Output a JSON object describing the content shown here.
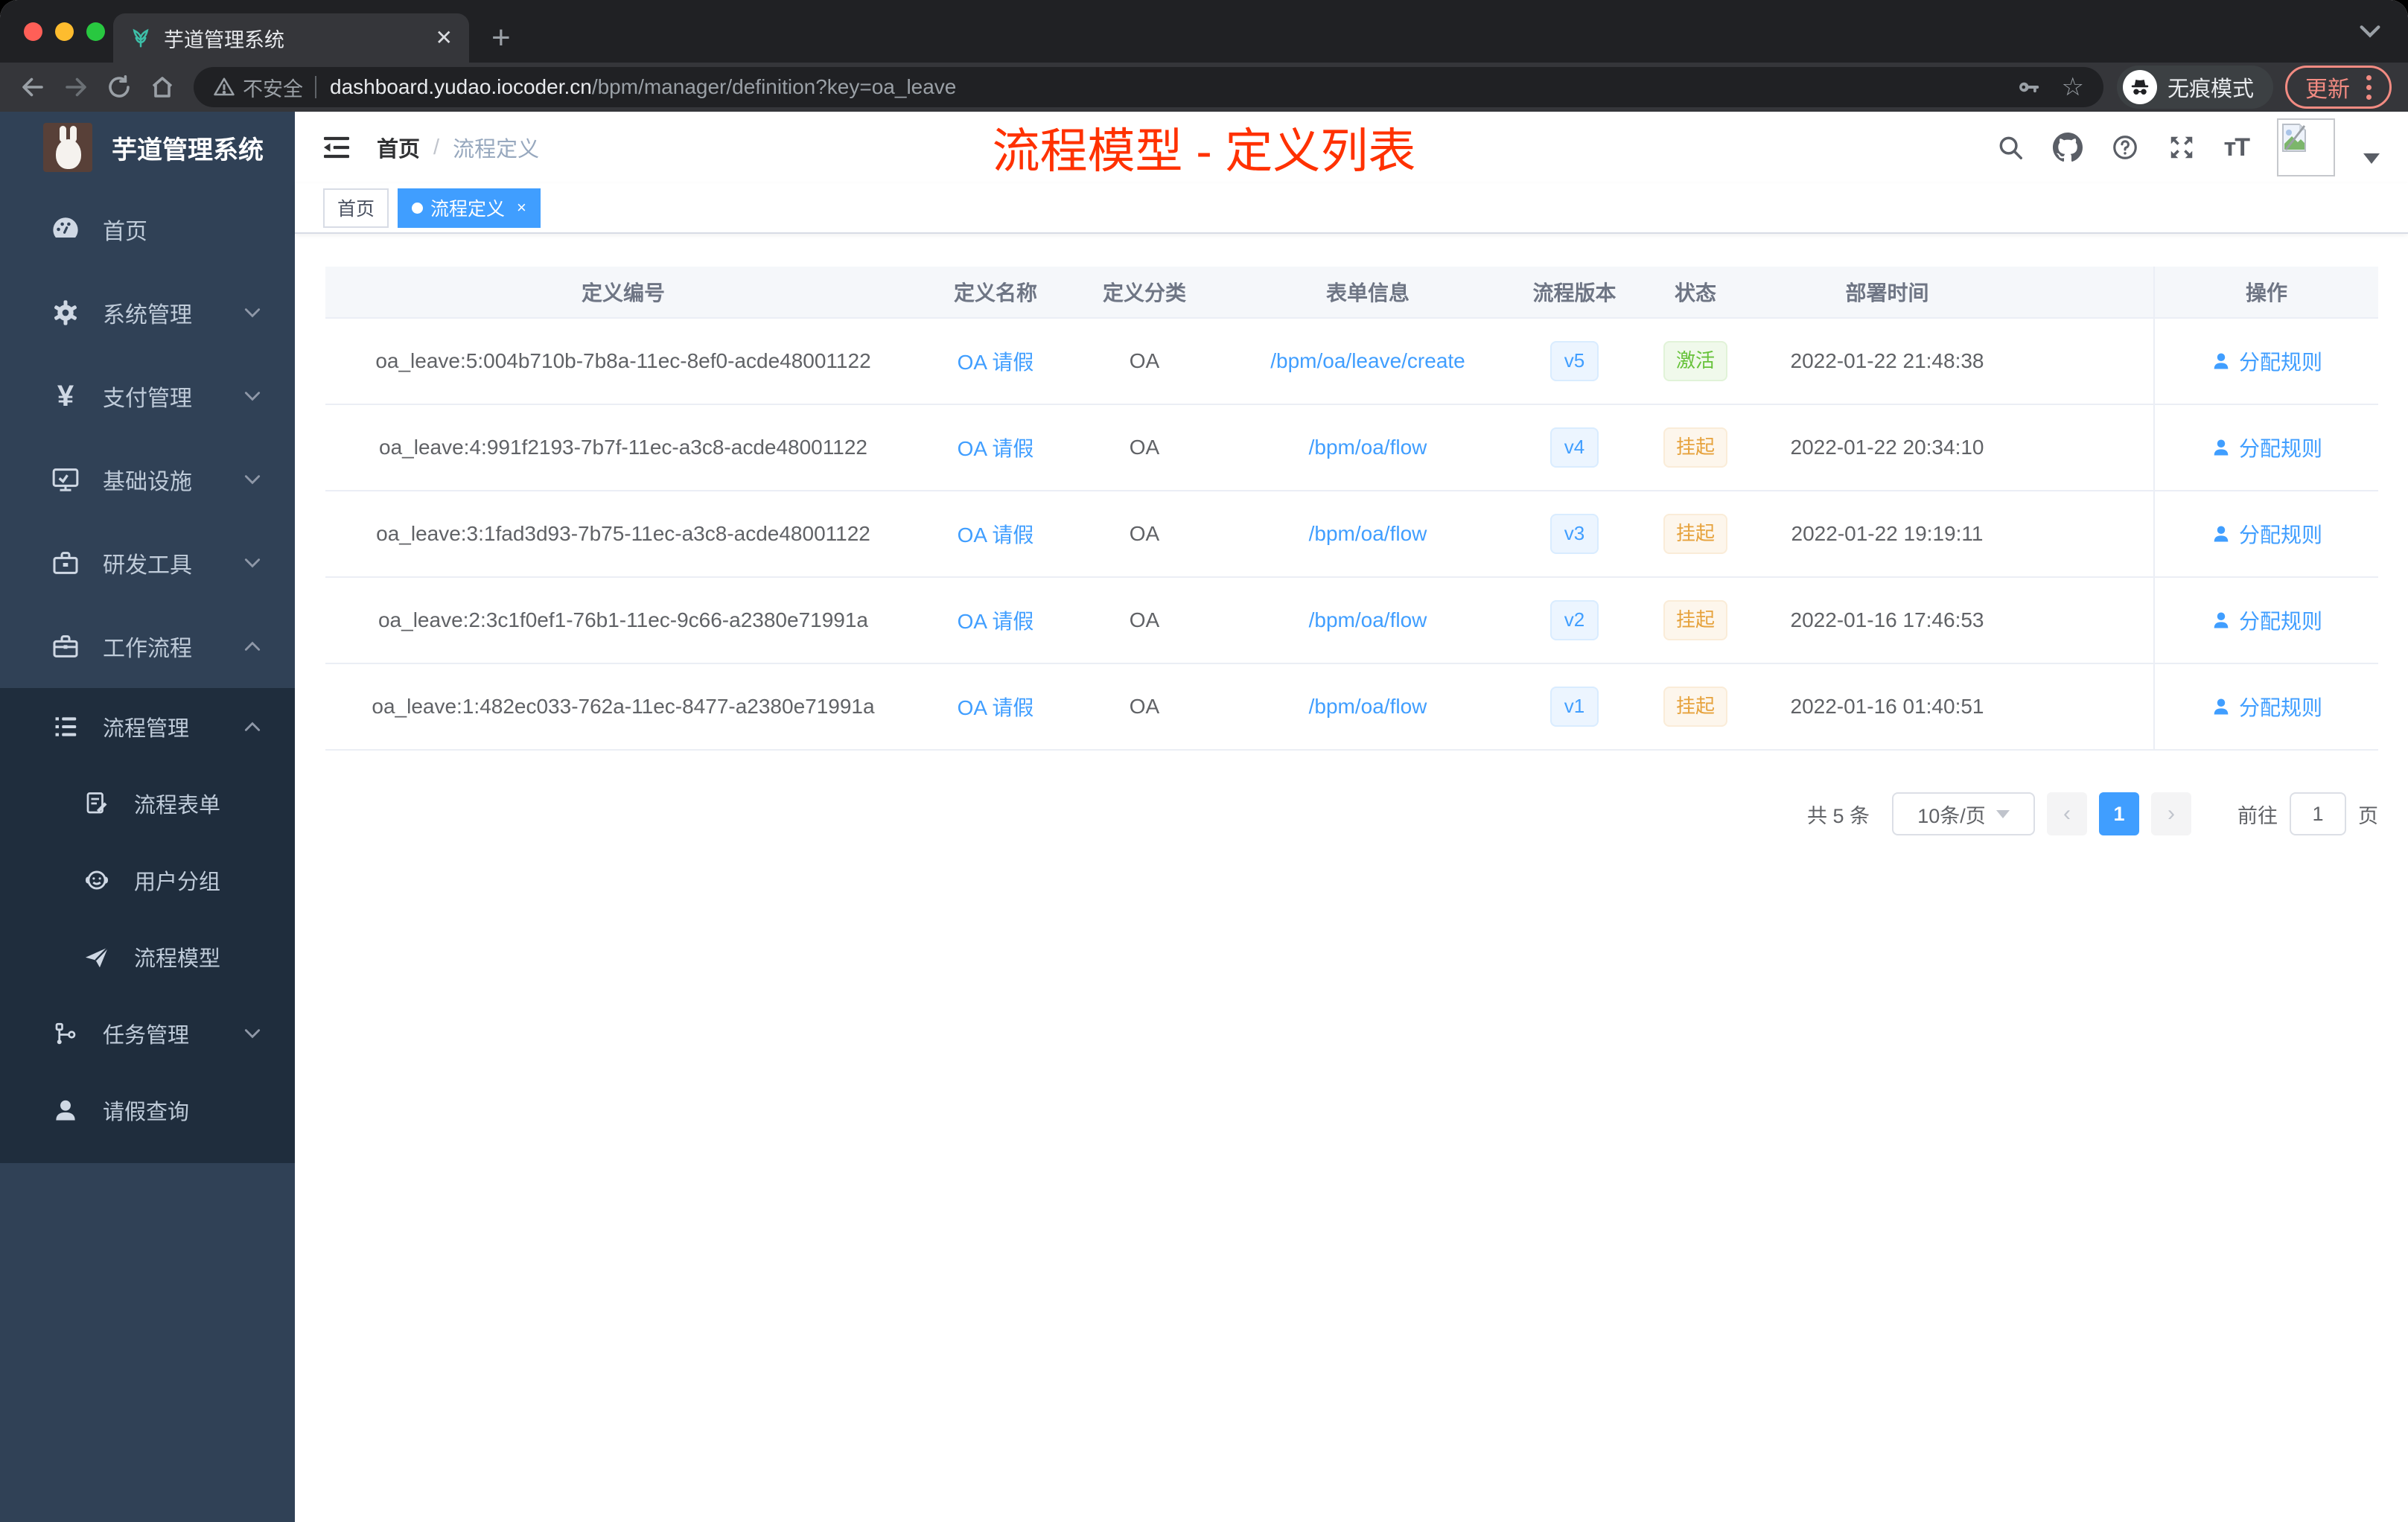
{
  "browser": {
    "tab_title": "芋道管理系统",
    "security_label": "不安全",
    "url_host": "dashboard.yudao.iocoder.cn",
    "url_path": "/bpm/manager/definition?key=oa_leave",
    "incognito_label": "无痕模式",
    "update_label": "更新"
  },
  "sidebar": {
    "logo_title": "芋道管理系统",
    "items": [
      {
        "label": "首页",
        "icon": "dashboard-icon"
      },
      {
        "label": "系统管理",
        "icon": "gear-icon",
        "state": "collapsed"
      },
      {
        "label": "支付管理",
        "icon": "yen-icon",
        "state": "collapsed"
      },
      {
        "label": "基础设施",
        "icon": "monitor-icon",
        "state": "collapsed"
      },
      {
        "label": "研发工具",
        "icon": "toolbox-icon",
        "state": "collapsed"
      },
      {
        "label": "工作流程",
        "icon": "briefcase-icon",
        "state": "expanded"
      }
    ],
    "workflow_submenu": {
      "process_mgmt": {
        "label": "流程管理",
        "state": "expanded"
      },
      "process_children": [
        {
          "label": "流程表单",
          "icon": "form-icon"
        },
        {
          "label": "用户分组",
          "icon": "user-group-icon"
        },
        {
          "label": "流程模型",
          "icon": "paper-plane-icon"
        }
      ],
      "task_mgmt": {
        "label": "任务管理",
        "state": "collapsed"
      },
      "leave_query": {
        "label": "请假查询"
      }
    }
  },
  "header": {
    "breadcrumb": {
      "home": "首页",
      "separator": "/",
      "current": "流程定义"
    },
    "overlay_title": "流程模型 - 定义列表"
  },
  "tags_view": {
    "home": "首页",
    "active": "流程定义",
    "close": "×"
  },
  "table": {
    "columns": {
      "id": "定义编号",
      "name": "定义名称",
      "category": "定义分类",
      "form": "表单信息",
      "version": "流程版本",
      "status": "状态",
      "deploy_time": "部署时间",
      "action": "操作"
    },
    "rows": [
      {
        "id": "oa_leave:5:004b710b-7b8a-11ec-8ef0-acde48001122",
        "name": "OA 请假",
        "category": "OA",
        "form": "/bpm/oa/leave/create",
        "version": "v5",
        "status": "激活",
        "status_type": "active",
        "deploy_time": "2022-01-22 21:48:38",
        "action": "分配规则"
      },
      {
        "id": "oa_leave:4:991f2193-7b7f-11ec-a3c8-acde48001122",
        "name": "OA 请假",
        "category": "OA",
        "form": "/bpm/oa/flow",
        "version": "v4",
        "status": "挂起",
        "status_type": "suspended",
        "deploy_time": "2022-01-22 20:34:10",
        "action": "分配规则"
      },
      {
        "id": "oa_leave:3:1fad3d93-7b75-11ec-a3c8-acde48001122",
        "name": "OA 请假",
        "category": "OA",
        "form": "/bpm/oa/flow",
        "version": "v3",
        "status": "挂起",
        "status_type": "suspended",
        "deploy_time": "2022-01-22 19:19:11",
        "action": "分配规则"
      },
      {
        "id": "oa_leave:2:3c1f0ef1-76b1-11ec-9c66-a2380e71991a",
        "name": "OA 请假",
        "category": "OA",
        "form": "/bpm/oa/flow",
        "version": "v2",
        "status": "挂起",
        "status_type": "suspended",
        "deploy_time": "2022-01-16 17:46:53",
        "action": "分配规则"
      },
      {
        "id": "oa_leave:1:482ec033-762a-11ec-8477-a2380e71991a",
        "name": "OA 请假",
        "category": "OA",
        "form": "/bpm/oa/flow",
        "version": "v1",
        "status": "挂起",
        "status_type": "suspended",
        "deploy_time": "2022-01-16 01:40:51",
        "action": "分配规则"
      }
    ]
  },
  "pagination": {
    "total": "共 5 条",
    "page_size": "10条/页",
    "prev": "‹",
    "next": "›",
    "current_page": "1",
    "goto_label": "前往",
    "page_unit": "页"
  },
  "colors": {
    "accent_blue": "#409eff",
    "overlay_title_red": "#ff3100",
    "status_active_green": "#67c23a",
    "status_suspended_orange": "#e6a23c",
    "sidebar_bg": "#304156",
    "sidebar_submenu_bg": "#1f2d3d",
    "chrome_dark": "#202124",
    "chrome_toolbar": "#35363a",
    "update_pill_red": "#f28b82"
  }
}
